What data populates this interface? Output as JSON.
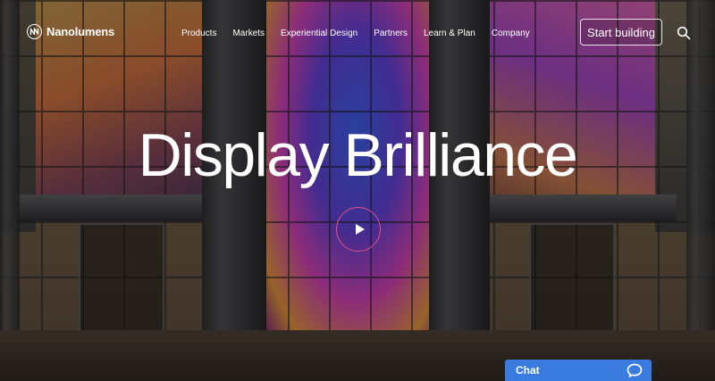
{
  "brand": {
    "name": "Nanolumens",
    "logo_icon": "nanolumens-logo-icon"
  },
  "nav": {
    "items": [
      {
        "label": "Products"
      },
      {
        "label": "Markets"
      },
      {
        "label": "Experiential Design"
      },
      {
        "label": "Partners"
      },
      {
        "label": "Learn & Plan"
      },
      {
        "label": "Company"
      }
    ],
    "cta_label": "Start building",
    "search_icon": "search-icon"
  },
  "hero": {
    "headline": "Display Brilliance",
    "play_icon": "play-icon",
    "accent_color": "#e0508a"
  },
  "chat": {
    "label": "Chat",
    "icon": "chat-bubble-icon",
    "color": "#3a7be0"
  }
}
